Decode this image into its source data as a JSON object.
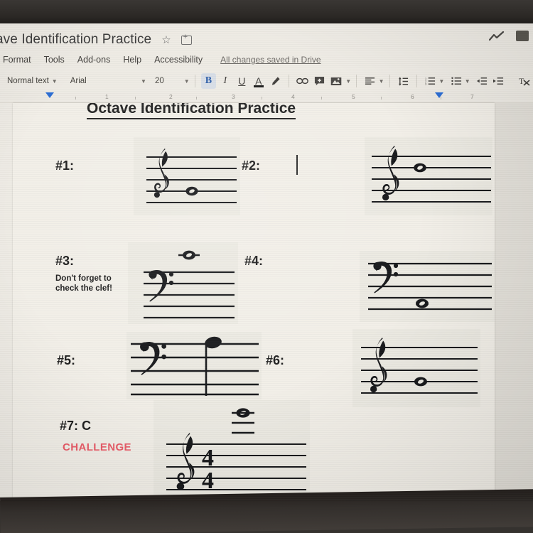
{
  "window": {
    "app": "Google Docs",
    "doc_title_truncated": "ave Identification Practice",
    "star_icon": "star-icon",
    "move_icon": "move-to-folder-icon",
    "activity_icon": "activity-dashboard-icon",
    "present_icon": "present-icon"
  },
  "menu": {
    "items": [
      "Format",
      "Tools",
      "Add-ons",
      "Help",
      "Accessibility"
    ],
    "save_status": "All changes saved in Drive"
  },
  "toolbar": {
    "paragraph_style": "Normal text",
    "font": "Arial",
    "font_size": "20",
    "bold_label": "B",
    "italic_label": "I",
    "underline_label": "U",
    "text_color_label": "A",
    "highlight_icon": "highlight-pen-icon",
    "link_icon": "insert-link-icon",
    "comment_icon": "add-comment-icon",
    "image_icon": "insert-image-icon",
    "align_icon": "align-left-icon",
    "line_spacing_icon": "line-spacing-icon",
    "numbered_list_icon": "numbered-list-icon",
    "bulleted_list_icon": "bulleted-list-icon",
    "decrease_indent_icon": "decrease-indent-icon",
    "increase_indent_icon": "increase-indent-icon",
    "clear_format_icon": "clear-formatting-icon",
    "bold_active": true
  },
  "ruler": {
    "numbers": [
      "1",
      "2",
      "3",
      "4",
      "5",
      "6",
      "7"
    ]
  },
  "document": {
    "heading": "Octave Identification Practice",
    "exercises": [
      {
        "label": "#1:",
        "clef": "treble",
        "note": "whole-note",
        "answer": ""
      },
      {
        "label": "#2:",
        "clef": "treble",
        "note": "whole-note",
        "answer": ""
      },
      {
        "label": "#3:",
        "clef": "bass",
        "note": "whole-note-ledger-above",
        "answer": "",
        "hint_line1": "Don't forget to",
        "hint_line2": "check the clef!"
      },
      {
        "label": "#4:",
        "clef": "bass",
        "note": "whole-note",
        "answer": ""
      },
      {
        "label": "#5:",
        "clef": "bass",
        "note": "half-note-stem-down",
        "answer": ""
      },
      {
        "label": "#6:",
        "clef": "treble",
        "note": "whole-note",
        "answer": ""
      },
      {
        "label": "#7: C",
        "clef": "treble",
        "note": "whole-note-ledger-above",
        "time_signature": "4/4",
        "answer": "C",
        "challenge": "CHALLENGE"
      }
    ]
  }
}
